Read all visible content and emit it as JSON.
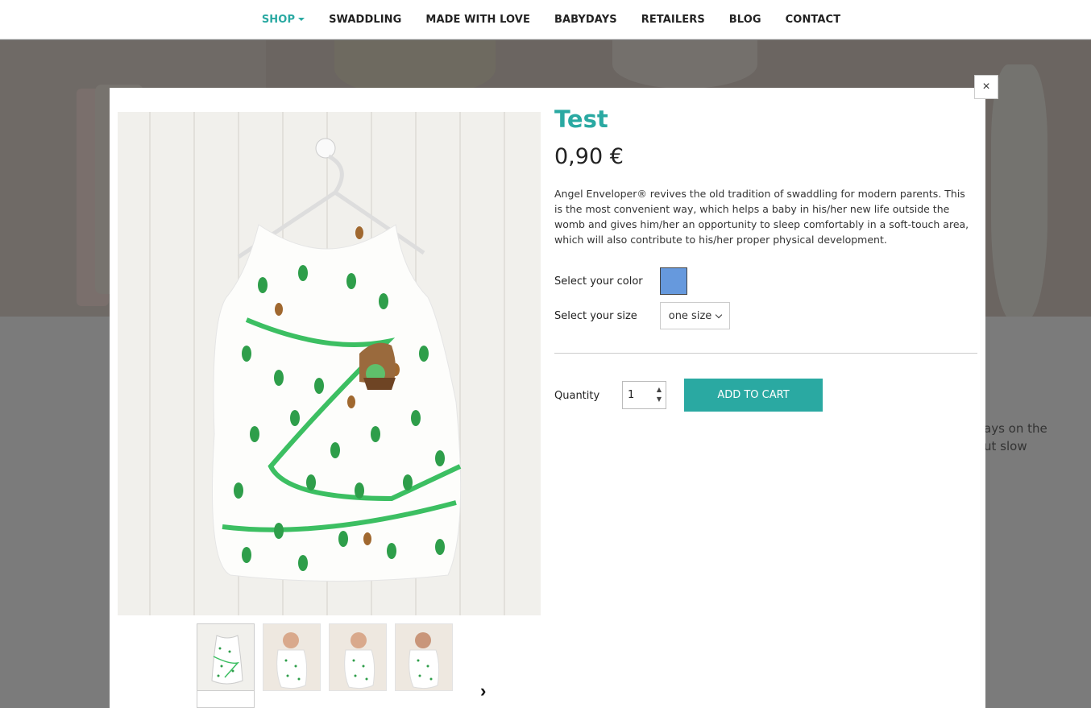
{
  "nav": {
    "items": [
      {
        "label": "SHOP",
        "active": true
      },
      {
        "label": "SWADDLING"
      },
      {
        "label": "MADE WITH LOVE"
      },
      {
        "label": "BABYDAYS"
      },
      {
        "label": "RETAILERS"
      },
      {
        "label": "BLOG"
      },
      {
        "label": "CONTACT"
      }
    ]
  },
  "background": {
    "line1": "ays on the",
    "line2": "ut slow"
  },
  "product": {
    "title": "Test",
    "price": "0,90 €",
    "description": "Angel Enveloper® revives the old tradition of swaddling for modern parents. This is the most convenient way, which helps a baby in his/her new life outside the womb and gives him/her an opportunity to sleep comfortably in a soft-touch area, which will also contribute to his/her proper physical development.",
    "color_label": "Select your color",
    "color_value": "#6699dd",
    "size_label": "Select your size",
    "size_value": "one size",
    "quantity_label": "Quantity",
    "quantity_value": "1",
    "add_to_cart": "ADD TO CART",
    "close_icon": "×",
    "next_icon": "›"
  },
  "colors": {
    "accent": "#2aa9a2",
    "leaf": "#2e9e4a"
  }
}
